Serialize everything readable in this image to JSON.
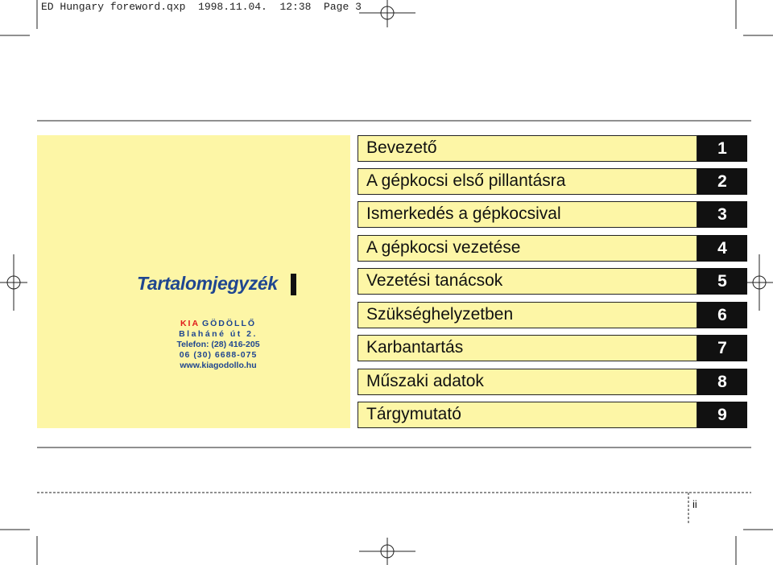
{
  "slug": "ED Hungary foreword.qxp  1998.11.04.  12:38  Page 3",
  "toc_title": "Tartalomjegyzék",
  "dealer": {
    "name_part1": "KIA",
    "name_part2": "GÖDÖLLŐ",
    "address": "Blaháné út 2.",
    "phone1": "Telefon: (28) 416-205",
    "phone2": "06 (30) 6688-075",
    "website": "www.kiagodollo.hu"
  },
  "chapters": [
    {
      "label": "Bevezető",
      "number": "1"
    },
    {
      "label": "A gépkocsi első pillantásra",
      "number": "2"
    },
    {
      "label": "Ismerkedés a gépkocsival",
      "number": "3"
    },
    {
      "label": "A gépkocsi vezetése",
      "number": "4"
    },
    {
      "label": "Vezetési tanácsok",
      "number": "5"
    },
    {
      "label": "Szükséghelyzetben",
      "number": "6"
    },
    {
      "label": "Karbantartás",
      "number": "7"
    },
    {
      "label": "Műszaki adatok",
      "number": "8"
    },
    {
      "label": "Tárgymutató",
      "number": "9"
    }
  ],
  "page_number": "ii",
  "colors": {
    "panel": "#fdf6a6",
    "title_blue": "#1f4690",
    "kia_red": "#e01c1c",
    "tab_black": "#111111"
  }
}
